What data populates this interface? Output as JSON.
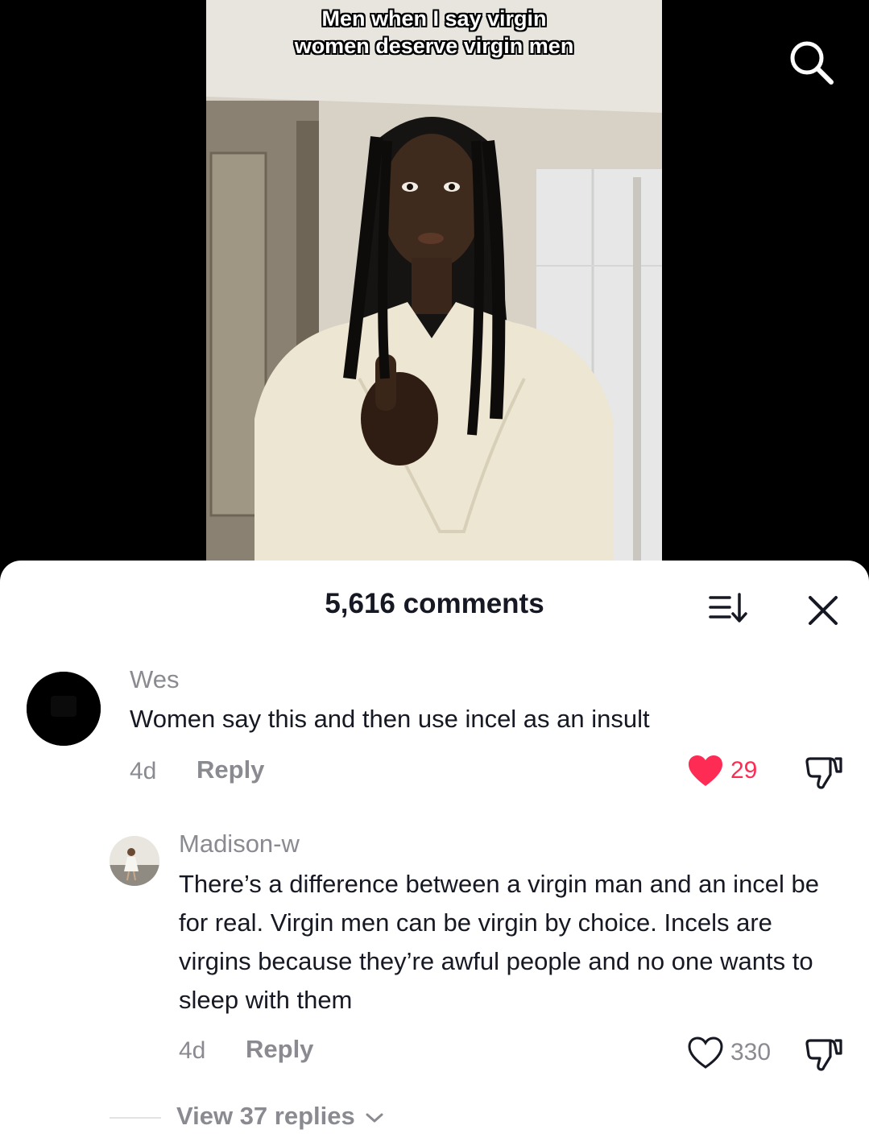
{
  "video": {
    "caption_line1": "Men when I say virgin",
    "caption_line2": "women deserve virgin men"
  },
  "comments_panel": {
    "title": "5,616 comments"
  },
  "comments": [
    {
      "username": "Wes",
      "text": "Women say this and then use incel as an insult",
      "age": "4d",
      "reply_label": "Reply",
      "likes": "29",
      "liked": true
    },
    {
      "username": "Madison-w",
      "text": "There’s a difference between a virgin man and an incel be for real. Virgin men can be virgin by choice. Incels are virgins because they’re awful people and no one wants to sleep with them",
      "age": "4d",
      "reply_label": "Reply",
      "likes": "330",
      "liked": false
    }
  ],
  "view_replies_label": "View 37 replies",
  "colors": {
    "like_active": "#fe2c55",
    "muted_text": "#8a8b91",
    "primary_text": "#161823"
  },
  "icons": [
    "search-icon",
    "sort-icon",
    "close-icon",
    "heart-icon",
    "dislike-icon",
    "chevron-down-icon"
  ]
}
